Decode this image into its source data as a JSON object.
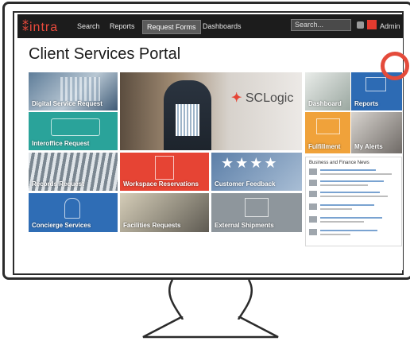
{
  "app": {
    "logo": "intra"
  },
  "nav": {
    "items": [
      "Search",
      "Reports",
      "Request Forms",
      "Dashboards"
    ],
    "active": "Request Forms"
  },
  "search": {
    "value": "Search..."
  },
  "user": {
    "label": "Admin"
  },
  "page": {
    "title": "Client Services Portal"
  },
  "hero": {
    "brand": "SCLogic"
  },
  "tiles": {
    "digital": "Digital Service Request",
    "interoffice": "Interoffice Request",
    "records": "Records Request",
    "concierge": "Concierge Services",
    "workspace": "Workspace Reservations",
    "customer": "Customer Feedback",
    "facilities": "Facilities Requests",
    "external": "External Shipments",
    "dashboard": "Dashboard",
    "reports": "Reports",
    "fulfillment": "Fulfillment",
    "myalerts": "My Alerts"
  },
  "news": {
    "title": "Business and Finance News"
  },
  "colors": {
    "accent": "#e84a3c",
    "teal": "#2aa39a",
    "blue": "#2d6bb4",
    "orange": "#f0a23a",
    "red": "#e64434",
    "gray": "#8e969c"
  }
}
